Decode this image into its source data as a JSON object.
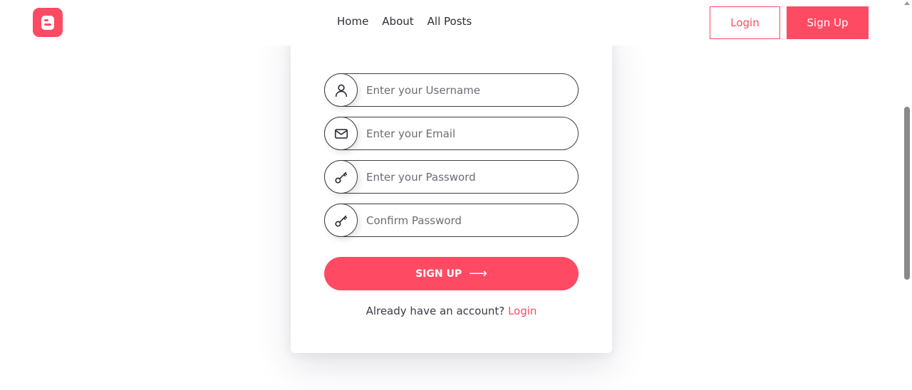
{
  "header": {
    "nav": [
      {
        "label": "Home"
      },
      {
        "label": "About"
      },
      {
        "label": "All Posts"
      }
    ],
    "login_label": "Login",
    "signup_label": "Sign Up"
  },
  "form": {
    "username_placeholder": "Enter your Username",
    "email_placeholder": "Enter your Email",
    "password_placeholder": "Enter your Password",
    "confirm_placeholder": "Confirm Password",
    "submit_label": "SIGN UP",
    "submit_arrow": "⟶",
    "account_prompt": "Already have an account?",
    "login_link": "Login"
  },
  "icons": {
    "logo": "blogger-logo-icon",
    "username": "user-icon",
    "email": "envelope-icon",
    "password": "key-icon",
    "confirm": "key-icon"
  },
  "colors": {
    "accent": "#ff4a64",
    "text": "#2d2d3a"
  }
}
